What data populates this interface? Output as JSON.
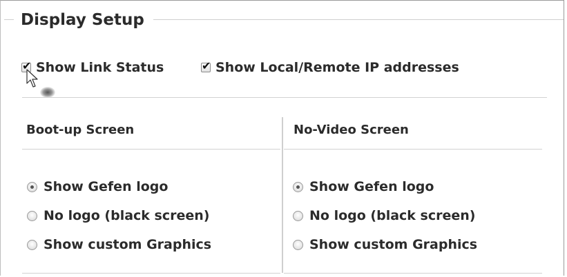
{
  "section": {
    "title": "Display Setup"
  },
  "checkboxes": [
    {
      "label": "Show Link Status",
      "checked": true
    },
    {
      "label": "Show Local/Remote IP addresses",
      "checked": true
    }
  ],
  "columns": [
    {
      "header": "Boot-up Screen",
      "options": [
        {
          "label": "Show Gefen logo",
          "selected": true
        },
        {
          "label": "No logo (black screen)",
          "selected": false
        },
        {
          "label": "Show custom Graphics",
          "selected": false
        }
      ]
    },
    {
      "header": "No-Video Screen",
      "options": [
        {
          "label": "Show Gefen logo",
          "selected": true
        },
        {
          "label": "No logo (black screen)",
          "selected": false
        },
        {
          "label": "Show custom Graphics",
          "selected": false
        }
      ]
    }
  ],
  "icons": {
    "check": "check-icon",
    "cursor": "mouse-pointer-icon"
  }
}
